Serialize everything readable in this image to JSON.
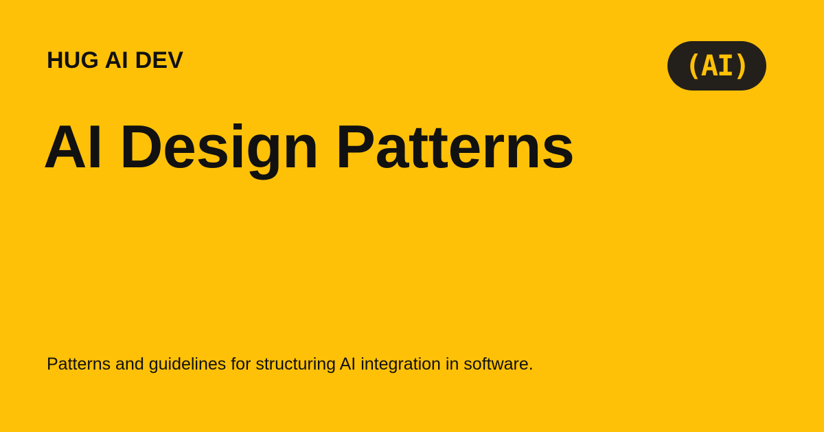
{
  "header": {
    "brand": "HUG AI DEV",
    "logo_text": "(AI)"
  },
  "main": {
    "title": "AI Design Patterns",
    "subtitle": "Patterns and guidelines for structuring AI integration in software."
  },
  "colors": {
    "background": "#FFC107",
    "text": "#111111",
    "logo_background": "#231F1A",
    "logo_text": "#FFC107"
  }
}
